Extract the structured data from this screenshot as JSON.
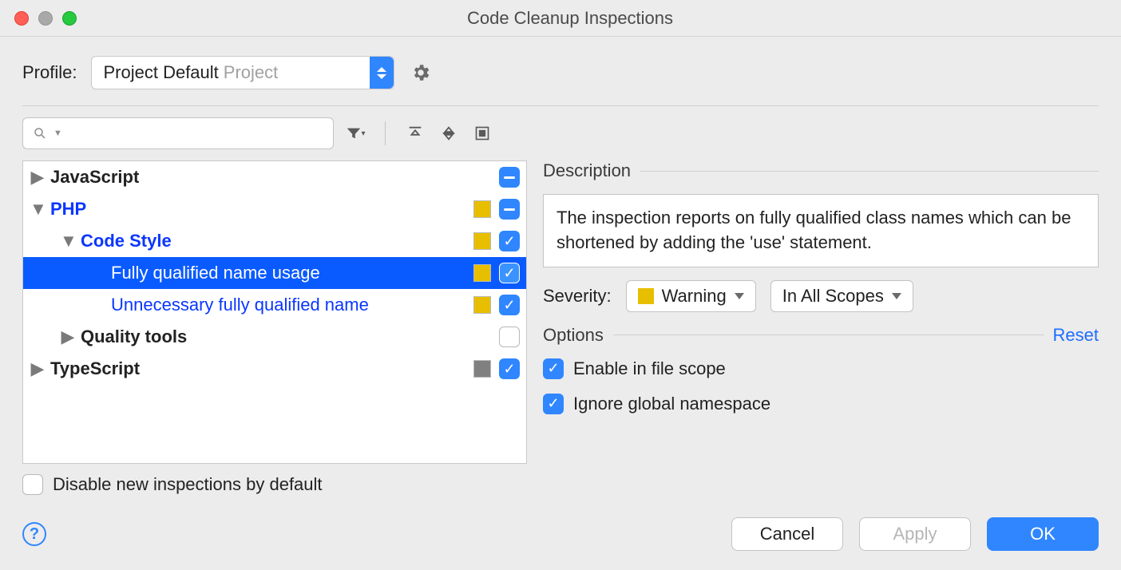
{
  "window": {
    "title": "Code Cleanup Inspections"
  },
  "profile": {
    "label": "Profile:",
    "value": "Project Default",
    "hint": "Project"
  },
  "tree": {
    "items": [
      {
        "label": "JavaScript",
        "bold": true,
        "arrow": "right",
        "indent": 1,
        "swatch": null,
        "check": "minus"
      },
      {
        "label": "PHP",
        "bold": true,
        "arrow": "down",
        "indent": 1,
        "swatch": "#e8bf00",
        "check": "minus",
        "link": true
      },
      {
        "label": "Code Style",
        "bold": true,
        "arrow": "down",
        "indent": 2,
        "swatch": "#e8bf00",
        "check": "checked",
        "link": true
      },
      {
        "label": "Fully qualified name usage",
        "bold": false,
        "arrow": "",
        "indent": 3,
        "swatch": "#e8bf00",
        "check": "checked",
        "selected": true
      },
      {
        "label": "Unnecessary fully qualified name",
        "bold": false,
        "arrow": "",
        "indent": 3,
        "swatch": "#e8bf00",
        "check": "checked",
        "link": true
      },
      {
        "label": "Quality tools",
        "bold": true,
        "arrow": "right",
        "indent": 2,
        "swatch": null,
        "check": "empty"
      },
      {
        "label": "TypeScript",
        "bold": true,
        "arrow": "right",
        "indent": 1,
        "swatch": "#808080",
        "check": "checked"
      }
    ]
  },
  "details": {
    "description_label": "Description",
    "description": "The inspection reports on fully qualified class names which can be shortened by adding the 'use' statement.",
    "severity_label": "Severity:",
    "severity_value": "Warning",
    "severity_swatch": "#e8bf00",
    "scope_value": "In All Scopes",
    "options_label": "Options",
    "reset": "Reset",
    "opt1": "Enable in file scope",
    "opt2": "Ignore global namespace"
  },
  "footer": {
    "disable_label": "Disable new inspections by default",
    "cancel": "Cancel",
    "apply": "Apply",
    "ok": "OK"
  }
}
